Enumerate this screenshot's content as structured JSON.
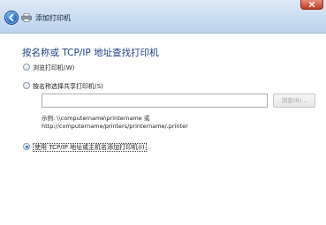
{
  "window": {
    "title": "添加打印机"
  },
  "page": {
    "heading": "按名称或 TCP/IP 地址查找打印机"
  },
  "options": {
    "browse_label": "浏览打印机(W)",
    "share_label": "按名称选择共享打印机(S)",
    "tcpip_label": "使用 TCP/IP 地址或主机名添加打印机(I)",
    "selected": "tcpip"
  },
  "share_field": {
    "value": "",
    "browse_button": "浏览(R)..."
  },
  "example": {
    "line1": "示例: \\\\computername\\printername 或",
    "line2": "http://computername/printers/printername/.printer"
  },
  "icons": {
    "back": "back-arrow-icon",
    "printer": "printer-icon",
    "close": "close-icon"
  },
  "colors": {
    "heading": "#1e3e8a",
    "titlebar": "#c9dcf1",
    "close": "#c23b21"
  }
}
